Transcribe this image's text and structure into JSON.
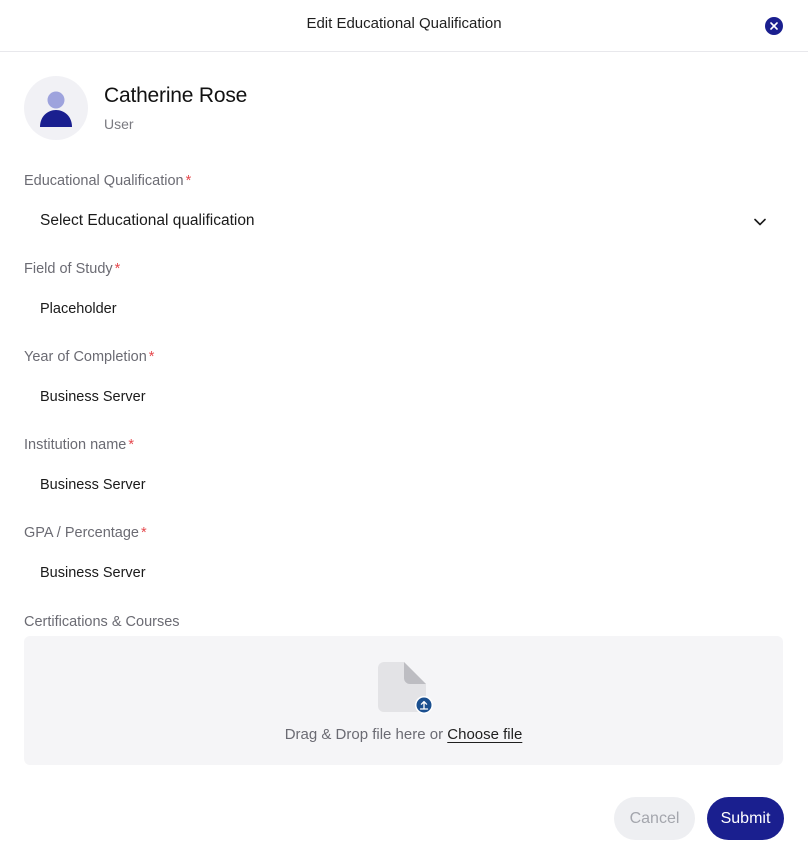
{
  "dialog": {
    "title": "Edit Educational Qualification"
  },
  "user": {
    "name": "Catherine Rose",
    "role": "User"
  },
  "fields": {
    "qualification": {
      "label": "Educational Qualification",
      "required": "*",
      "value": "Select Educational qualification"
    },
    "field_of_study": {
      "label": "Field of Study",
      "required": "*",
      "value": "Placeholder"
    },
    "year_of_completion": {
      "label": "Year of Completion",
      "required": "*",
      "value": "Business Server"
    },
    "institution_name": {
      "label": "Institution name",
      "required": "*",
      "value": "Business Server"
    },
    "gpa": {
      "label": "GPA / Percentage",
      "required": "*",
      "value": "Business Server"
    }
  },
  "certifications": {
    "label": "Certifications & Courses",
    "drop_text": "Drag & Drop file here or",
    "choose_file": "Choose file"
  },
  "actions": {
    "cancel": "Cancel",
    "submit": "Submit"
  },
  "colors": {
    "primary": "#1a1f8f",
    "required": "#e5484d"
  },
  "icons": [
    "close-icon",
    "user-icon",
    "chevron-down-icon",
    "file-icon",
    "upload-icon"
  ]
}
